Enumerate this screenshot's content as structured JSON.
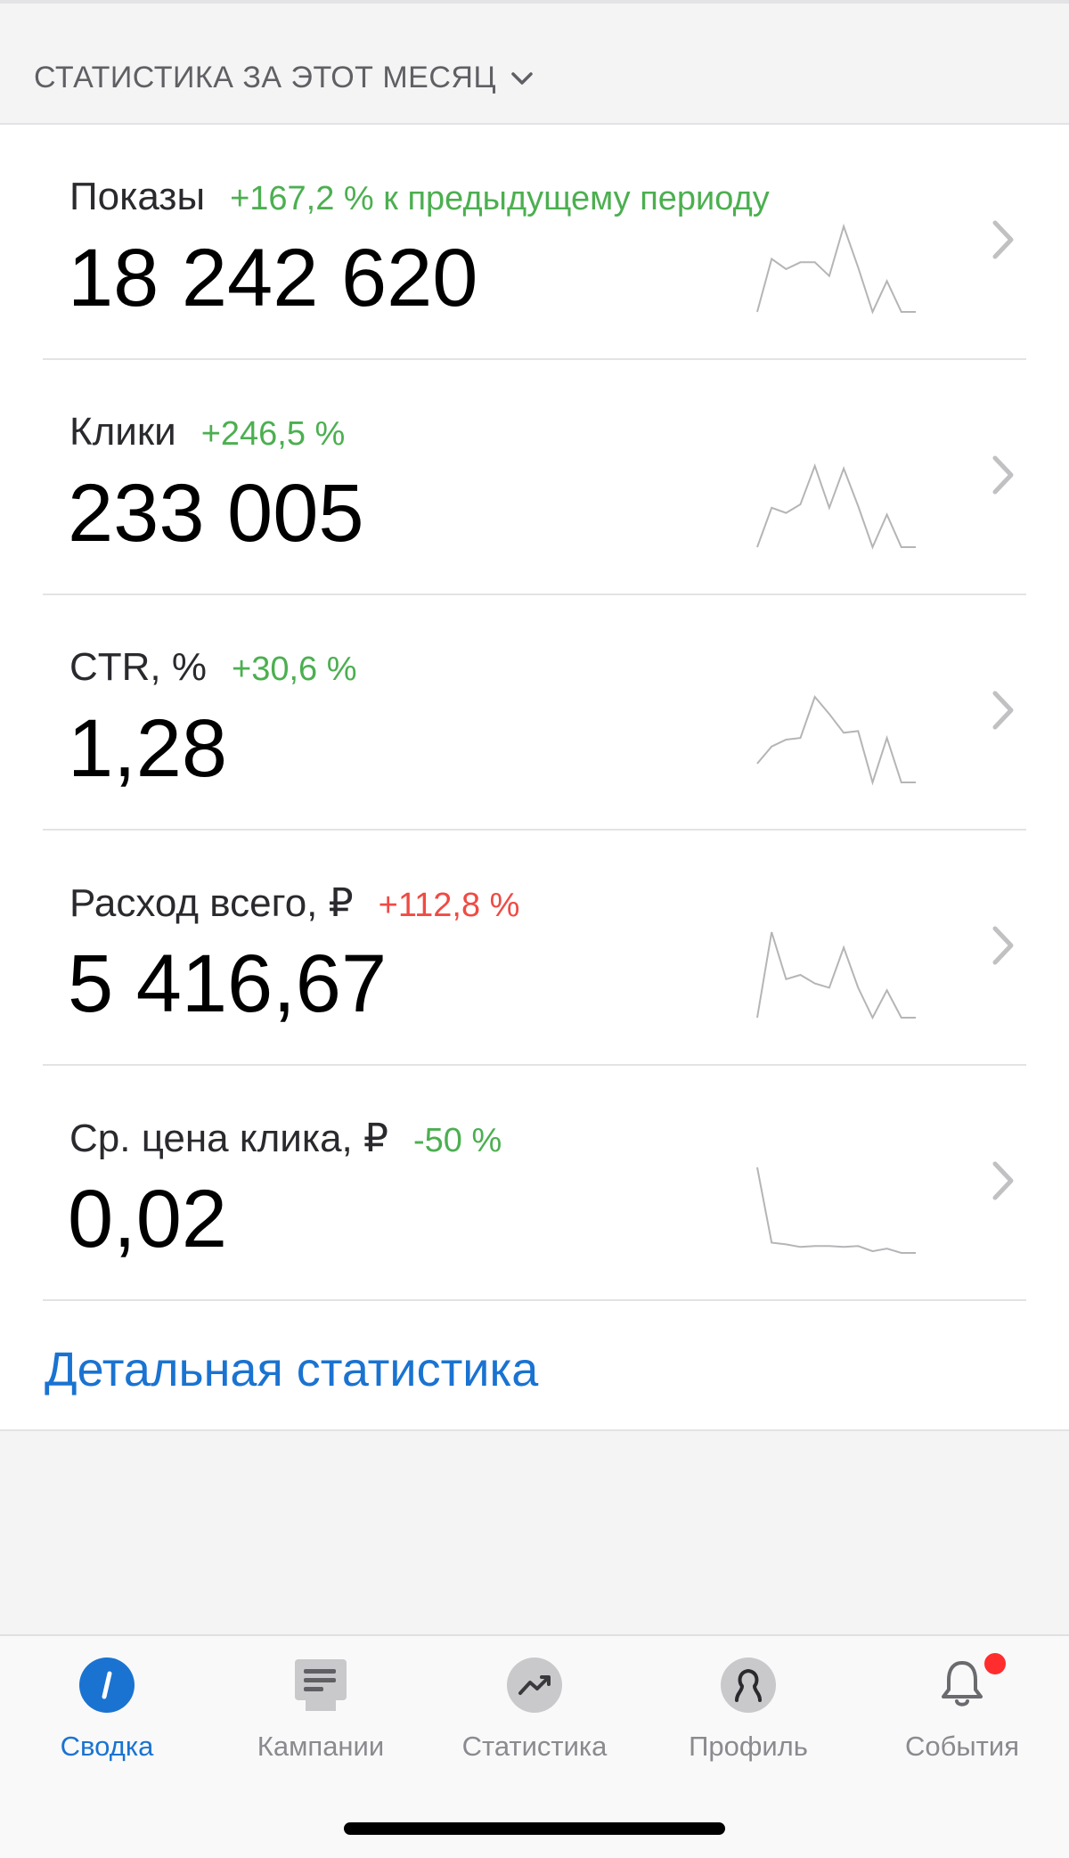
{
  "header": {
    "period_label": "СТАТИСТИКА ЗА ЭТОТ МЕСЯЦ"
  },
  "stats": [
    {
      "label": "Показы",
      "delta": "+167,2 % к предыдущему периоду",
      "delta_color": "#4caf50",
      "value": "18 242 620",
      "trend": [
        0.0,
        0.62,
        0.5,
        0.58,
        0.58,
        0.42,
        1.0,
        0.52,
        0.0,
        0.36,
        0.0,
        0.0
      ]
    },
    {
      "label": "Клики",
      "delta": "+246,5 %",
      "delta_color": "#4caf50",
      "value": "233 005",
      "trend": [
        0.0,
        0.46,
        0.4,
        0.5,
        0.95,
        0.46,
        0.92,
        0.48,
        0.0,
        0.38,
        0.0,
        0.0
      ]
    },
    {
      "label": "CTR, %",
      "delta": "+30,6 %",
      "delta_color": "#4caf50",
      "value": "1,28",
      "trend": [
        0.22,
        0.42,
        0.5,
        0.52,
        1.0,
        0.8,
        0.58,
        0.6,
        0.0,
        0.52,
        0.0,
        0.0
      ]
    },
    {
      "label": "Расход всего, ₽",
      "delta": "+112,8 %",
      "delta_color": "#ef4b45",
      "value": "5 416,67",
      "trend": [
        0.0,
        1.0,
        0.45,
        0.5,
        0.4,
        0.35,
        0.82,
        0.35,
        0.0,
        0.32,
        0.0,
        0.0
      ]
    },
    {
      "label": "Ср. цена клика, ₽",
      "delta": "-50 %",
      "delta_color": "#4caf50",
      "value": "0,02",
      "trend": [
        1.0,
        0.12,
        0.1,
        0.07,
        0.08,
        0.08,
        0.07,
        0.08,
        0.02,
        0.05,
        0.0,
        0.0
      ]
    }
  ],
  "detail_link": "Детальная статистика",
  "tabs": [
    {
      "label": "Сводка",
      "icon": "summary-icon",
      "active": true
    },
    {
      "label": "Кампании",
      "icon": "campaigns-icon",
      "active": false
    },
    {
      "label": "Статистика",
      "icon": "statistics-icon",
      "active": false
    },
    {
      "label": "Профиль",
      "icon": "profile-icon",
      "active": false
    },
    {
      "label": "События",
      "icon": "bell-icon",
      "active": false,
      "badge": true
    }
  ],
  "colors": {
    "accent": "#1a73d1",
    "positive": "#4caf50",
    "negative": "#ef4b45",
    "sparkline": "#b5b5b8",
    "badge": "#ff2d2d"
  }
}
